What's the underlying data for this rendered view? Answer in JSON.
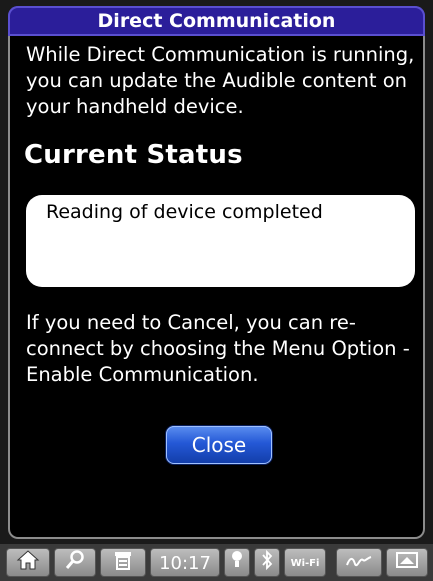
{
  "window": {
    "title": "Direct Communication"
  },
  "main": {
    "intro_text": "While Direct Communication is running, you can update the Audible content on your handheld device.",
    "status_heading": "Current Status",
    "status_text": "Reading of device completed",
    "cancel_note": "If you need to Cancel, you can re-connect by choosing the Menu Option - Enable Communication.",
    "close_label": "Close"
  },
  "taskbar": {
    "clock": "10:17",
    "wifi_label": "Wi-Fi",
    "icons": [
      "home-icon",
      "search-icon",
      "menu-icon",
      "clock",
      "alert-icon",
      "bluetooth-icon",
      "wifi-icon",
      "signature-icon",
      "window-icon"
    ]
  },
  "colors": {
    "titlebar": "#2b1e9a",
    "screen_bg": "#000000",
    "button_blue": "#2458d6"
  }
}
